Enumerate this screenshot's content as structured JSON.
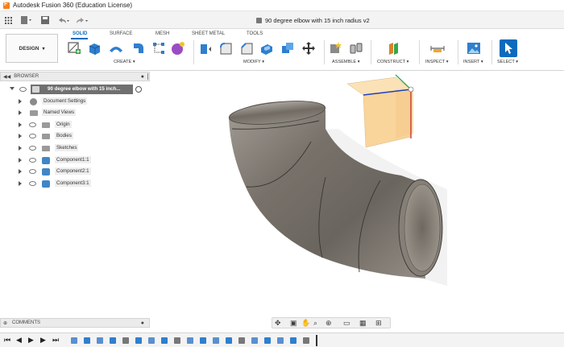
{
  "window": {
    "title": "Autodesk Fusion 360 (Education License)"
  },
  "document": {
    "tab_title": "90 degree elbow with 15 inch radius v2"
  },
  "workspace": {
    "label": "DESIGN"
  },
  "ribbon": {
    "tabs": [
      "SOLID",
      "SURFACE",
      "MESH",
      "SHEET METAL",
      "TOOLS"
    ],
    "active_tab": "SOLID",
    "groups": [
      "CREATE",
      "MODIFY",
      "ASSEMBLE",
      "CONSTRUCT",
      "INSPECT",
      "INSERT",
      "SELECT"
    ]
  },
  "browser": {
    "header": "BROWSER",
    "root": "90 degree elbow with 15 inch...",
    "items": [
      {
        "label": "Document Settings",
        "icon": "gear-icon"
      },
      {
        "label": "Named Views",
        "icon": "folder-icon"
      },
      {
        "label": "Origin",
        "icon": "folder-icon"
      },
      {
        "label": "Bodies",
        "icon": "folder-icon"
      },
      {
        "label": "Sketches",
        "icon": "folder-icon"
      },
      {
        "label": "Component1:1",
        "icon": "component-icon"
      },
      {
        "label": "Component2:1",
        "icon": "component-icon"
      },
      {
        "label": "Component3:1",
        "icon": "component-icon"
      }
    ]
  },
  "comments": {
    "header": "COMMENTS"
  },
  "colors": {
    "accent": "#0b6bbd",
    "model_metal": "#8a8479",
    "viewcube_face": "#f9d9a4"
  }
}
